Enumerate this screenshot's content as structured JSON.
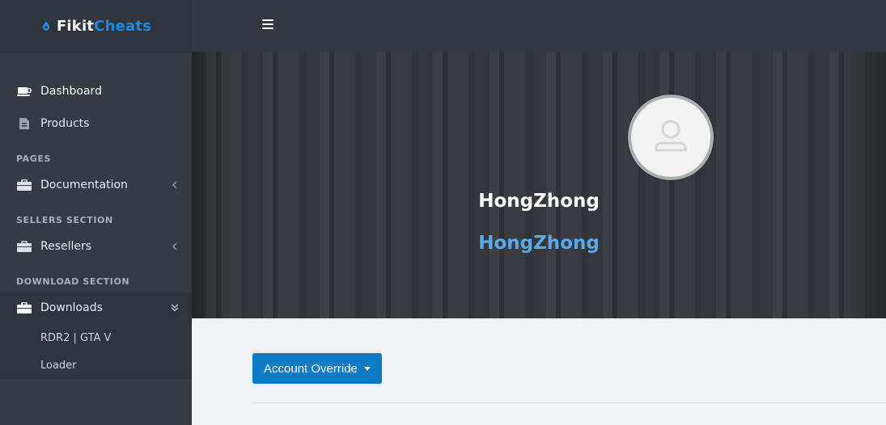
{
  "brand": {
    "part1": "Fikit",
    "part2": "Cheats",
    "accent": "#1e88e5"
  },
  "sidebar": {
    "items_main": [
      {
        "label": "Dashboard",
        "icon": "coffee-cup-icon",
        "active": true
      },
      {
        "label": "Products",
        "icon": "document-icon"
      }
    ],
    "sections": [
      {
        "title": "PAGES",
        "items": [
          {
            "label": "Documentation",
            "icon": "briefcase-icon",
            "chevron": "chevron-left"
          }
        ]
      },
      {
        "title": "SELLERS SECTION",
        "items": [
          {
            "label": "Resellers",
            "icon": "briefcase-icon",
            "chevron": "chevron-left"
          }
        ]
      },
      {
        "title": "DOWNLOAD SECTION",
        "items": [
          {
            "label": "Downloads",
            "icon": "briefcase-icon",
            "chevron": "double-chevron-down"
          }
        ]
      }
    ],
    "submenu": [
      "RDR2 | GTA V",
      "Loader"
    ]
  },
  "topbar": {
    "menu_icon": "hamburger-icon"
  },
  "profile": {
    "name": "HongZhong",
    "subtitle": "HongZhong",
    "subtitle_color": "#5aa9e6"
  },
  "actions": {
    "account_override": "Account Override"
  }
}
